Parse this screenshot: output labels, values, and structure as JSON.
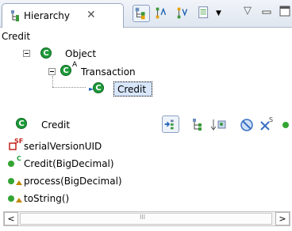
{
  "view": {
    "tab_title": "Hierarchy",
    "tab_close": "✕",
    "menu_triangle": "▽"
  },
  "breadcrumb": "Credit",
  "tree": {
    "object_label": "Object",
    "transaction_label": "Transaction",
    "transaction_modifier": "A",
    "credit_label": "Credit"
  },
  "members_header": {
    "class_label": "Credit"
  },
  "members": [
    {
      "modifier": "SF",
      "label": "serialVersionUID"
    },
    {
      "modifier": "C",
      "label": "Credit(BigDecimal)"
    },
    {
      "modifier": "",
      "label": "process(BigDecimal)"
    },
    {
      "modifier": "",
      "label": "toString()"
    }
  ],
  "scrollbar": {
    "left": "<",
    "right": ">",
    "grip": "III"
  },
  "colors": {
    "class_green": "#1e9a39",
    "selection": "#d7e6fb",
    "tabbar": "#dfe6f0"
  }
}
